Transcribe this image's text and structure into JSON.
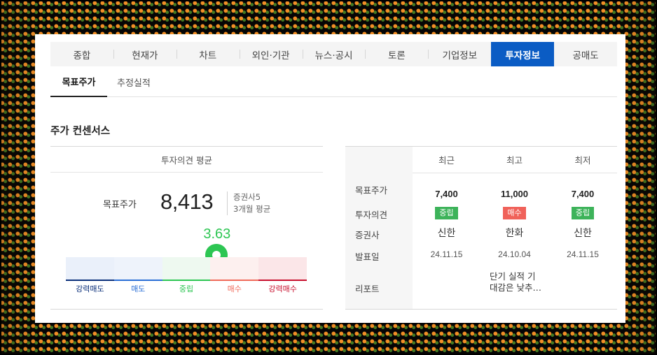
{
  "tabs": [
    {
      "label": "종합"
    },
    {
      "label": "현재가"
    },
    {
      "label": "차트"
    },
    {
      "label": "외인·기관"
    },
    {
      "label": "뉴스·공시"
    },
    {
      "label": "토론"
    },
    {
      "label": "기업정보"
    },
    {
      "label": "투자정보",
      "active": true
    },
    {
      "label": "공매도"
    }
  ],
  "subtabs": [
    {
      "label": "목표주가",
      "active": true
    },
    {
      "label": "추정실적"
    }
  ],
  "section_title": "주가 컨센서스",
  "consensus": {
    "header": "투자의견 평균",
    "target_label": "목표주가",
    "target_value": "8,413",
    "brokers": "증권사5",
    "period": "3개월 평균",
    "score": "3.63",
    "score_value": 3.63,
    "scale": [
      {
        "label": "강력매도",
        "color": "#0b2f7a",
        "fill": "#eaf0fa"
      },
      {
        "label": "매도",
        "color": "#2b6fd6",
        "fill": "#eef3fb"
      },
      {
        "label": "중립",
        "color": "#2dc653",
        "fill": "#eef9f0"
      },
      {
        "label": "매수",
        "color": "#f06a5a",
        "fill": "#fdf0ef"
      },
      {
        "label": "강력매수",
        "color": "#c8102e",
        "fill": "#fbe6e8"
      }
    ]
  },
  "report_table": {
    "columns": [
      "최근",
      "최고",
      "최저"
    ],
    "row_labels": [
      "목표주가",
      "투자의견",
      "증권사",
      "발표일",
      "리포트"
    ],
    "target_prices": [
      "7,400",
      "11,000",
      "7,400"
    ],
    "opinions": [
      {
        "label": "중립",
        "color": "#3db35a"
      },
      {
        "label": "매수",
        "color": "#f0625a"
      },
      {
        "label": "중립",
        "color": "#3db35a"
      }
    ],
    "brokers": [
      "신한",
      "한화",
      "신한"
    ],
    "dates": [
      "24.11.15",
      "24.10.04",
      "24.11.15"
    ],
    "reports": [
      "",
      "단기 실적 기 대감은 낮추…",
      ""
    ]
  }
}
